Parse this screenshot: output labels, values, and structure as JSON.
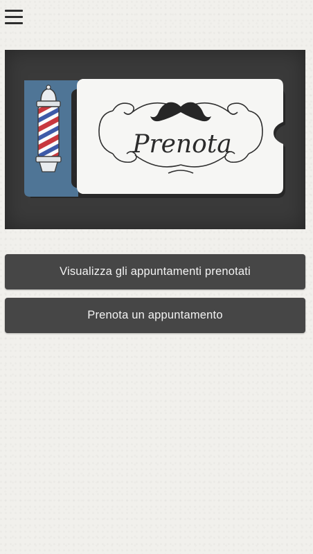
{
  "menu": {
    "icon": "menu-icon"
  },
  "banner": {
    "ticket_text": "Prenota",
    "icons": [
      "barber-pole-icon",
      "mustache-icon"
    ],
    "colors": {
      "background": "#3a3a3a",
      "stub": "#4f7596",
      "ticket": "#f6f6f4"
    }
  },
  "actions": {
    "view_appointments": "Visualizza gli appuntamenti prenotati",
    "book_appointment": "Prenota un appuntamento"
  }
}
